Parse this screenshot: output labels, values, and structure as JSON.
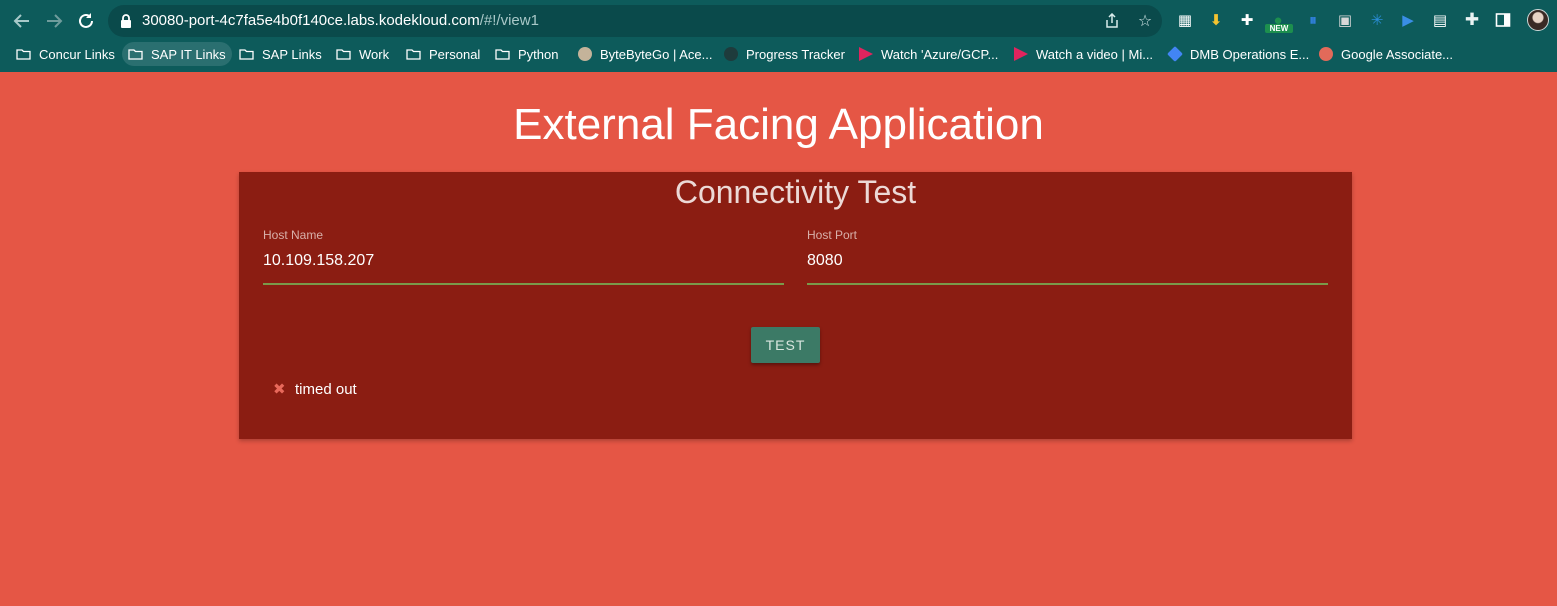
{
  "browser": {
    "url_host": "30080-port-4c7fa5e4b0f140ce.labs.kodekloud.com",
    "url_path": "/#!/view1",
    "extensions": [
      {
        "name": "qr-extension-icon",
        "color": "#ffffff",
        "glyph": "▦"
      },
      {
        "name": "download-extension-icon",
        "color": "#f4c430",
        "glyph": "⬇"
      },
      {
        "name": "plus-extension-icon",
        "color": "#ffffff",
        "glyph": "✚"
      },
      {
        "name": "new-extension-icon",
        "color": "#1d8f4e",
        "glyph": "●"
      },
      {
        "name": "pause-extension-icon",
        "color": "#2f7fd8",
        "glyph": "⏸"
      },
      {
        "name": "tile-extension-icon",
        "color": "#d7d7d7",
        "glyph": "▣"
      },
      {
        "name": "star-burst-extension-icon",
        "color": "#2b8ed8",
        "glyph": "✳"
      },
      {
        "name": "play-extension-icon",
        "color": "#3a8ee6",
        "glyph": "▶"
      },
      {
        "name": "doc-extension-icon",
        "color": "#ffffff",
        "glyph": "▤"
      }
    ],
    "new_badge": "NEW"
  },
  "bookmarks": [
    {
      "label": "Concur Links",
      "type": "folder"
    },
    {
      "label": "SAP IT Links",
      "type": "folder"
    },
    {
      "label": "SAP Links",
      "type": "folder"
    },
    {
      "label": "Work",
      "type": "folder"
    },
    {
      "label": "Personal",
      "type": "folder"
    },
    {
      "label": "Python",
      "type": "folder"
    },
    {
      "label": "ByteByteGo | Ace...",
      "type": "site"
    },
    {
      "label": "Progress Tracker",
      "type": "site"
    },
    {
      "label": "Watch 'Azure/GCP...",
      "type": "site"
    },
    {
      "label": "Watch a video | Mi...",
      "type": "site"
    },
    {
      "label": "DMB Operations E...",
      "type": "site"
    },
    {
      "label": "Google Associate...",
      "type": "site"
    }
  ],
  "page": {
    "title": "External Facing Application",
    "card_title": "Connectivity Test",
    "host_name_label": "Host Name",
    "host_name_value": "10.109.158.207",
    "host_port_label": "Host Port",
    "host_port_value": "8080",
    "test_button": "TEST",
    "result_text": "timed out"
  },
  "colors": {
    "page_bg": "#e55645",
    "card_bg": "#8b1d12",
    "chrome_bg": "#0d5b5b",
    "button_bg": "#3c7a66",
    "field_underline": "#7a9a4a"
  }
}
